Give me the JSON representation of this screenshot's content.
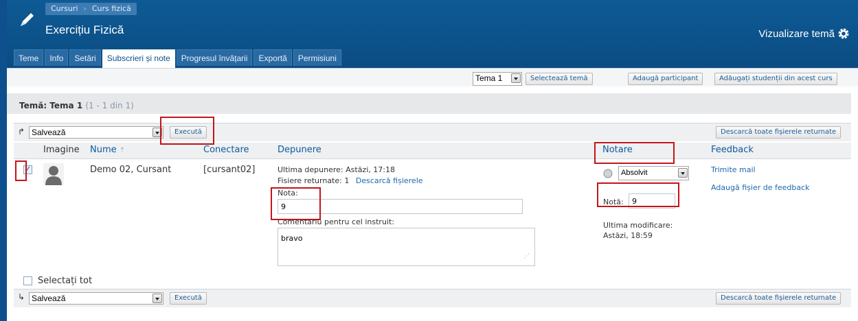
{
  "breadcrumbs": [
    "Cursuri",
    "Curs fizică"
  ],
  "page_title": "Exercițiu Fizică",
  "view_theme_label": "Vizualizare temă",
  "tabs": [
    {
      "label": "Teme"
    },
    {
      "label": "Info"
    },
    {
      "label": "Setări"
    },
    {
      "label": "Subscrieri și note",
      "active": true
    },
    {
      "label": "Progresul învățarii"
    },
    {
      "label": "Exportă"
    },
    {
      "label": "Permisiuni"
    }
  ],
  "toolbar": {
    "theme_select_value": "Tema 1",
    "select_theme_button": "Selectează temă",
    "add_participant_button": "Adaugă participant",
    "add_students_button": "Adăugați studenții din acest curs"
  },
  "theme_heading": {
    "label": "Temă: Tema 1",
    "count": "(1 - 1 din 1)"
  },
  "action_top": {
    "select_value": "Salvează",
    "execute_button": "Execută",
    "download_button": "Descarcă toate fișierele returnate"
  },
  "columns": {
    "image": "Imagine",
    "name": "Nume",
    "login": "Conectare",
    "submission": "Depunere",
    "grading": "Notare",
    "feedback": "Feedback"
  },
  "row": {
    "checked": true,
    "name": "Demo 02, Cursant",
    "login": "[cursant02]",
    "last_submission": "Ultima depunere: Astăzi, 17:18",
    "returned_files": "Fisiere returnate: 1",
    "download_files_link": "Descarcă fișierele",
    "grade_label": "Nota:",
    "grade_value": "9",
    "comment_label": "Comentariu pentru cel instruit:",
    "comment_value": "bravo",
    "status_select": "Absolvit",
    "note_label": "Notă:",
    "note_value": "9",
    "last_modified_label": "Ultima modificare:",
    "last_modified_value": "Astăzi, 18:59",
    "send_mail_link": "Trimite mail",
    "add_feedback_link": "Adaugă fișier de feedback"
  },
  "select_all_label": "Selectați tot",
  "action_bottom": {
    "select_value": "Salvează",
    "execute_button": "Execută",
    "download_button": "Descarcă toate fișierele returnate"
  },
  "colors": {
    "header_blue": "#0e4f8d",
    "highlight_red": "#c2141a",
    "link_blue": "#1b67ad"
  }
}
